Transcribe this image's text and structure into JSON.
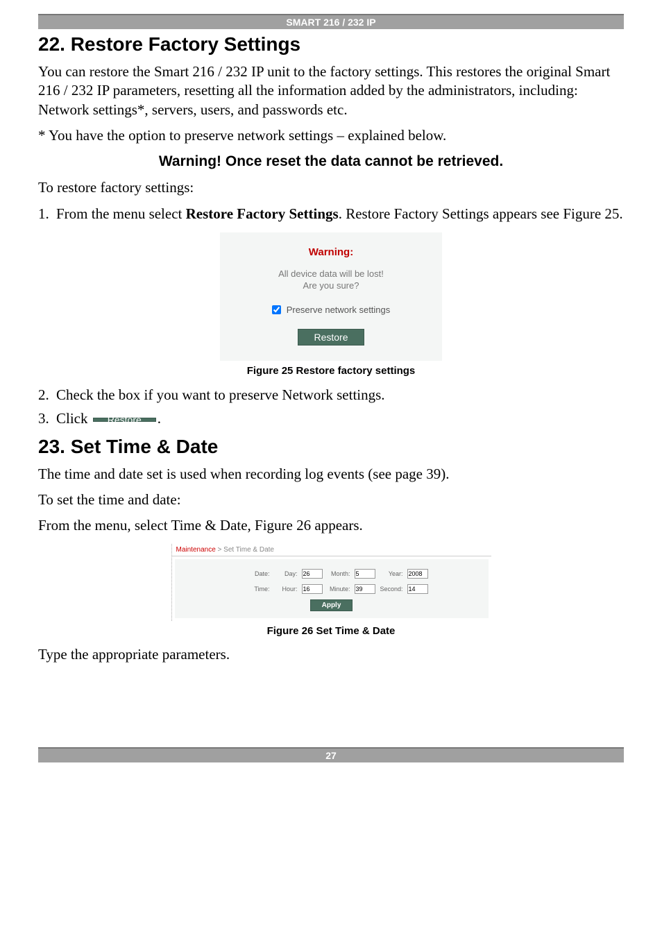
{
  "banner": "SMART 216 / 232 IP",
  "section22": {
    "title": "22. Restore Factory Settings",
    "p1": "You can restore the Smart 216 / 232 IP unit to the factory settings. This restores the original Smart 216 / 232 IP parameters, resetting all the information added by the administrators, including: Network settings*, servers, users, and passwords etc.",
    "p2": "* You have the option to preserve network settings – explained below.",
    "warning": "Warning! Once reset the data cannot be retrieved.",
    "p3": "To restore factory settings:",
    "step1_a": "From the menu select ",
    "step1_b": "Restore Factory Settings",
    "step1_c": ". Restore Factory Settings appears see Figure 25.",
    "step2": "Check the box if you want to preserve Network settings.",
    "step3_a": "Click ",
    "step3_b": "."
  },
  "fig25": {
    "title": "Warning:",
    "msg1": "All device data will be lost!",
    "msg2": "Are you sure?",
    "checkbox_label": "Preserve network settings",
    "button": "Restore",
    "caption": "Figure 25 Restore factory settings"
  },
  "restore_btn": "Restore",
  "section23": {
    "title": "23. Set Time & Date",
    "p1": "The time and date set is used when recording log events (see page 39).",
    "p2": "To set the time and date:",
    "p3": "From the menu, select Time & Date, Figure 26 appears."
  },
  "fig26": {
    "crumb1": "Maintenance",
    "crumb_sep": " > ",
    "crumb2": "Set Time & Date",
    "date_label": "Date:",
    "day_label": "Day:",
    "day": "26",
    "month_label": "Month:",
    "month": "5",
    "year_label": "Year:",
    "year": "2008",
    "time_label": "Time:",
    "hour_label": "Hour:",
    "hour": "16",
    "minute_label": "Minute:",
    "minute": "39",
    "second_label": "Second:",
    "second": "14",
    "apply": "Apply",
    "caption": "Figure 26 Set Time & Date"
  },
  "last_p": "Type the appropriate parameters.",
  "page_num": "27"
}
